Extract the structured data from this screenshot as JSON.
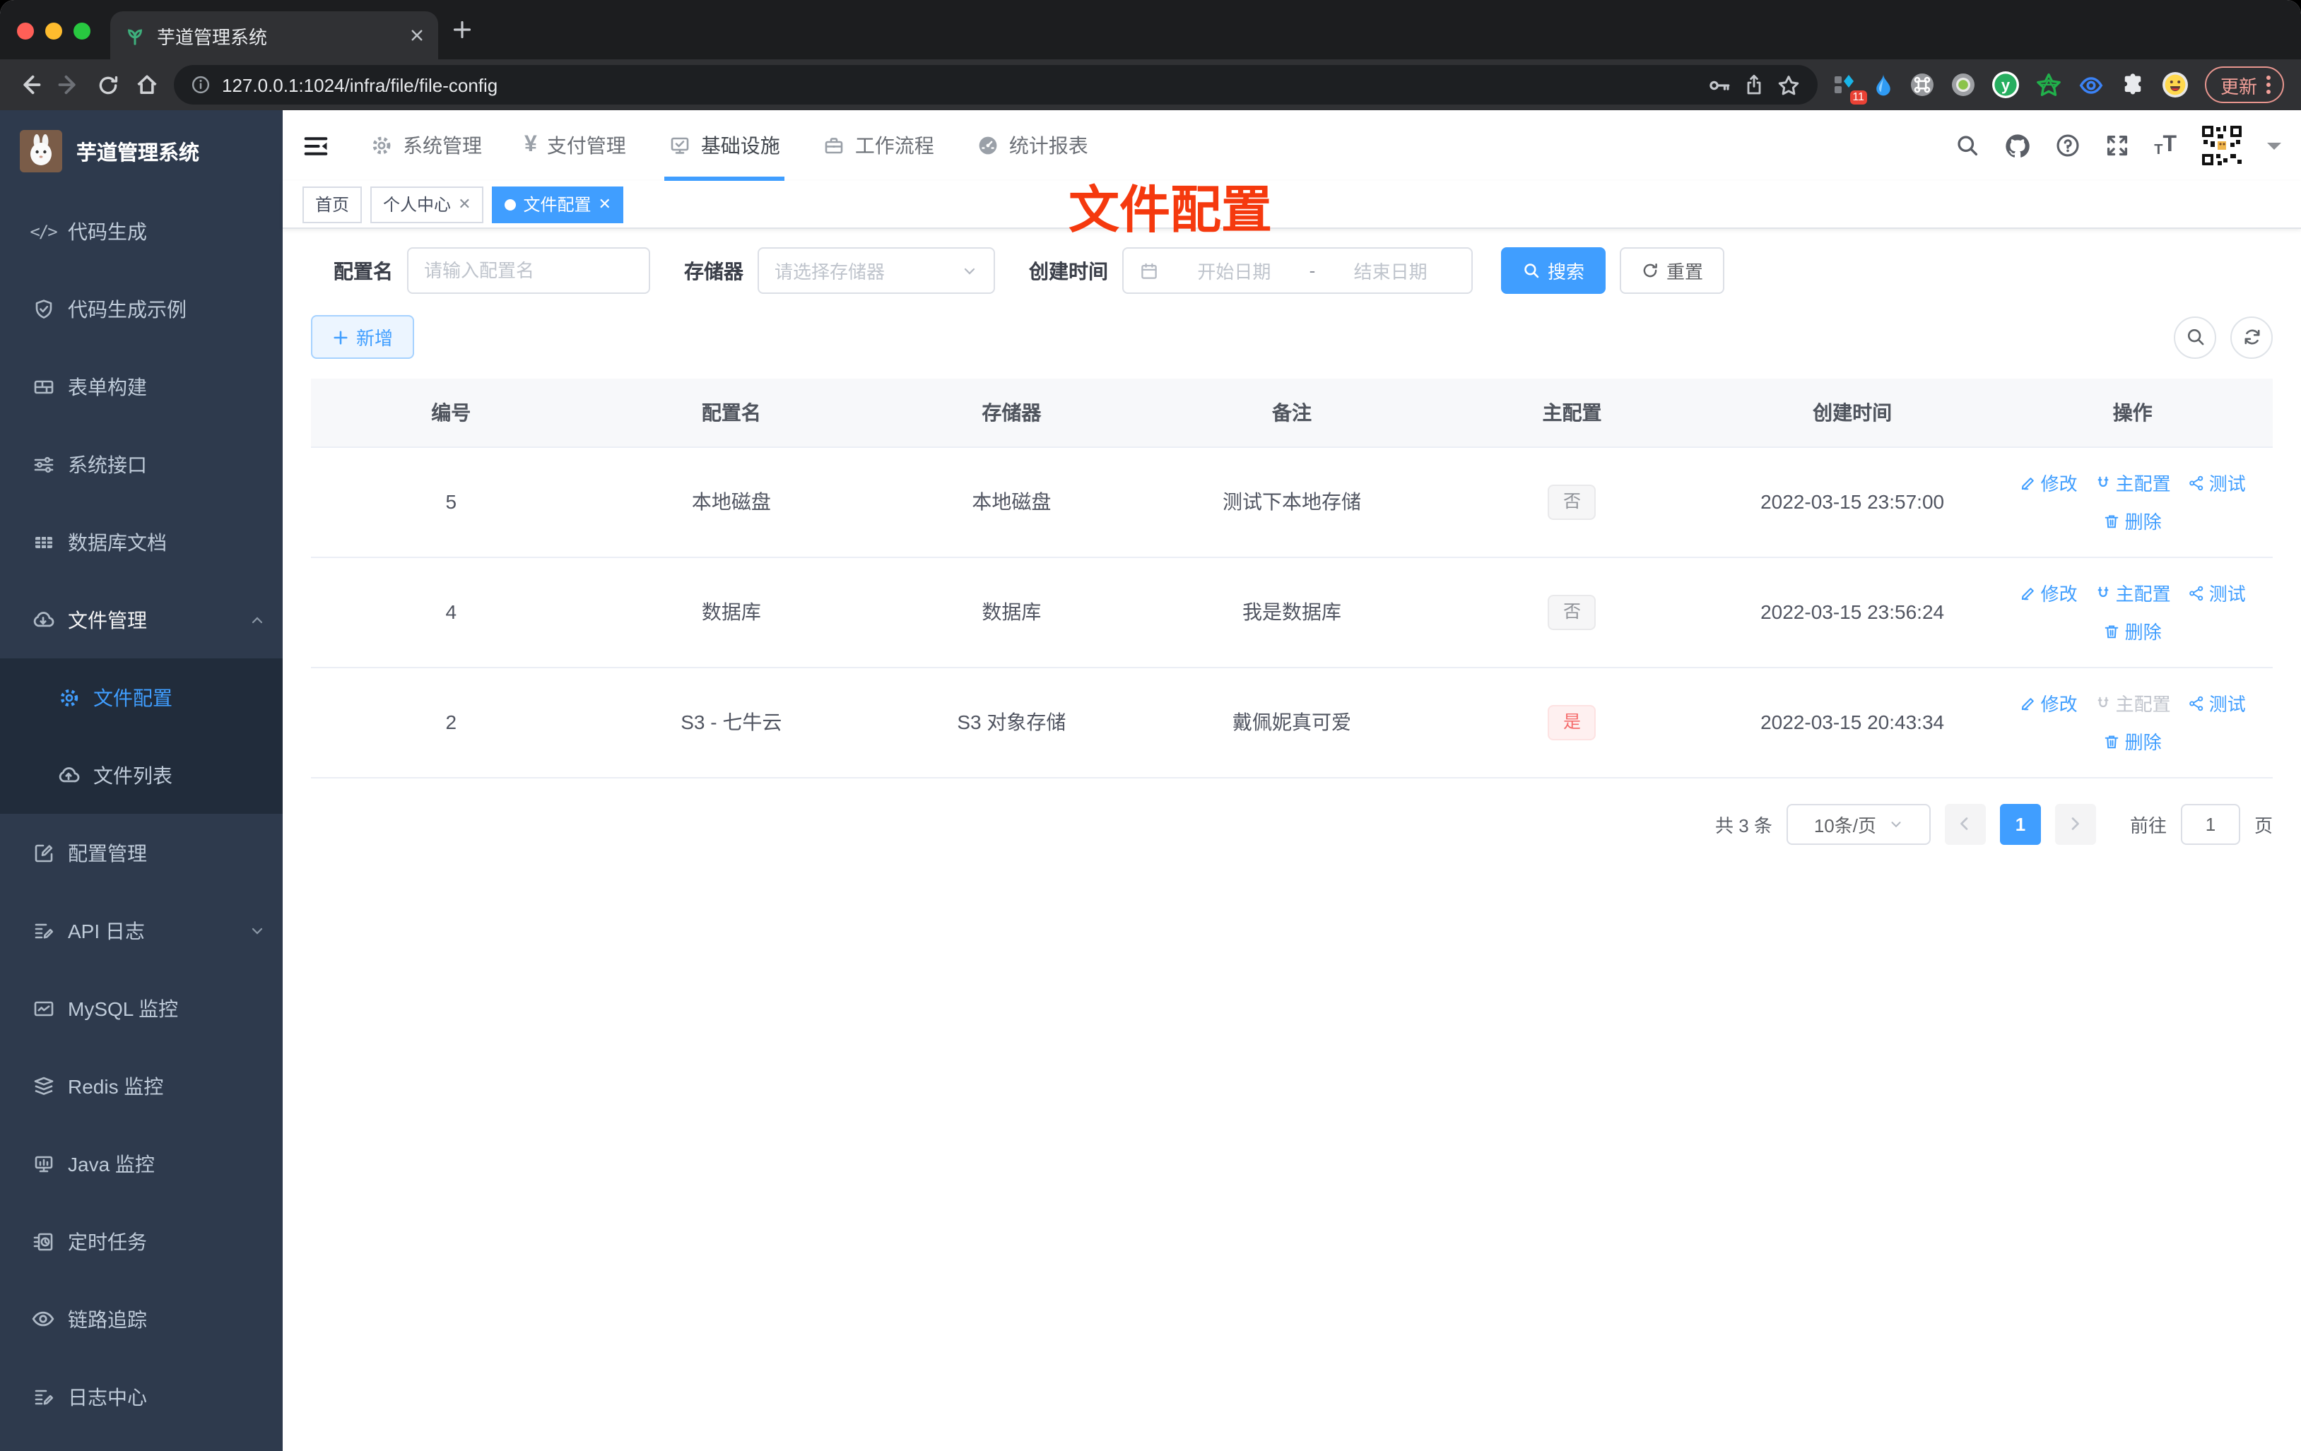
{
  "colors": {
    "accent": "#409eff",
    "danger": "#f56c6c",
    "annotation_red": "#f5390e",
    "sidebar_bg": "#2e3a4d"
  },
  "browser": {
    "tab_title": "芋道管理系统",
    "url": "127.0.0.1:1024/infra/file/file-config",
    "extension_badge": "11",
    "update_label": "更新"
  },
  "app": {
    "logo_title": "芋道管理系统",
    "annotation": "文件配置"
  },
  "topnav": {
    "items": [
      {
        "label": "系统管理"
      },
      {
        "label": "支付管理"
      },
      {
        "label": "基础设施"
      },
      {
        "label": "工作流程"
      },
      {
        "label": "统计报表"
      }
    ]
  },
  "tags": [
    {
      "label": "首页"
    },
    {
      "label": "个人中心"
    },
    {
      "label": "文件配置"
    }
  ],
  "sidebar": {
    "items": [
      {
        "label": "代码生成"
      },
      {
        "label": "代码生成示例"
      },
      {
        "label": "表单构建"
      },
      {
        "label": "系统接口"
      },
      {
        "label": "数据库文档"
      },
      {
        "label": "文件管理"
      },
      {
        "label": "文件配置"
      },
      {
        "label": "文件列表"
      },
      {
        "label": "配置管理"
      },
      {
        "label": "API 日志"
      },
      {
        "label": "MySQL 监控"
      },
      {
        "label": "Redis 监控"
      },
      {
        "label": "Java 监控"
      },
      {
        "label": "定时任务"
      },
      {
        "label": "链路追踪"
      },
      {
        "label": "日志中心"
      }
    ]
  },
  "filters": {
    "name_label": "配置名",
    "name_placeholder": "请输入配置名",
    "storage_label": "存储器",
    "storage_placeholder": "请选择存储器",
    "time_label": "创建时间",
    "start_placeholder": "开始日期",
    "separator": "-",
    "end_placeholder": "结束日期",
    "search_label": "搜索",
    "reset_label": "重置"
  },
  "toolbar": {
    "add_label": "新增"
  },
  "table": {
    "columns": [
      "编号",
      "配置名",
      "存储器",
      "备注",
      "主配置",
      "创建时间",
      "操作"
    ],
    "action_labels": {
      "edit": "修改",
      "master": "主配置",
      "test": "测试",
      "del": "删除"
    },
    "rows": [
      {
        "id": "5",
        "name": "本地磁盘",
        "storage": "本地磁盘",
        "remark": "测试下本地存储",
        "master": "否",
        "created": "2022-03-15 23:57:00"
      },
      {
        "id": "4",
        "name": "数据库",
        "storage": "数据库",
        "remark": "我是数据库",
        "master": "否",
        "created": "2022-03-15 23:56:24"
      },
      {
        "id": "2",
        "name": "S3 - 七牛云",
        "storage": "S3 对象存储",
        "remark": "戴佩妮真可爱",
        "master": "是",
        "created": "2022-03-15 20:43:34"
      }
    ]
  },
  "pagination": {
    "total": "共 3 条",
    "page_size": "10条/页",
    "page": "1",
    "goto_prefix": "前往",
    "goto_value": "1",
    "goto_suffix": "页"
  }
}
